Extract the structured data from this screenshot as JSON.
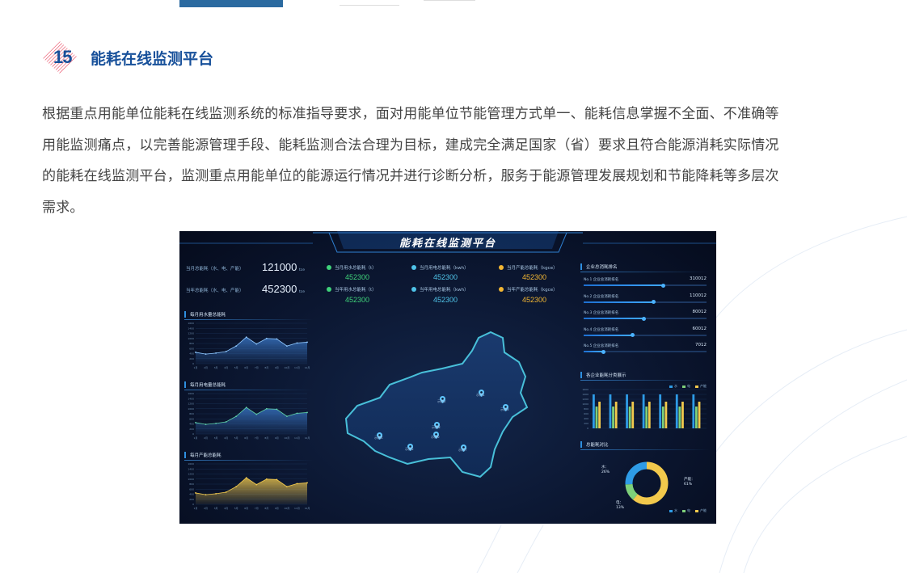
{
  "section": {
    "number": "15",
    "title": "能耗在线监测平台",
    "paragraph_lines": [
      "根据重点用能单位能耗在线监测系统的标准指导要求，面对用能单位节能管理方式单一、能耗信息掌握不全面、不准确等",
      "用能监测痛点，以完善能源管理手段、能耗监测合法合理为目标，建成完全满足国家（省）要求且符合能源消耗实际情况",
      "的能耗在线监测平台，监测重点用能单位的能源运行情况并进行诊断分析，服务于能源管理发展规划和节能降耗等多层次",
      "需求。"
    ]
  },
  "dashboard": {
    "title": "能耗在线监测平台",
    "summary": [
      {
        "label": "当月总能耗（水、电、产能）",
        "value": "121000",
        "unit": "tce"
      },
      {
        "label": "当年总能耗（水、电、产能）",
        "value": "452300",
        "unit": "tce"
      }
    ],
    "kpis": [
      {
        "label": "当月用水总能耗（t）",
        "value": "452300",
        "color": "#3fd27a"
      },
      {
        "label": "当月用电总能耗（kwh）",
        "value": "452300",
        "color": "#4fc3e8"
      },
      {
        "label": "当月产能总能耗（kgce）",
        "value": "452300",
        "color": "#f2b633"
      },
      {
        "label": "当年用水总能耗（t）",
        "value": "452300",
        "color": "#3fd27a"
      },
      {
        "label": "当年用电总能耗（kwh）",
        "value": "452300",
        "color": "#4fc3e8"
      },
      {
        "label": "当年产能总能耗（kgce）",
        "value": "452300",
        "color": "#f2b633"
      }
    ],
    "panels": {
      "water": "每月用水量总能耗",
      "electric": "每月用电量总能耗",
      "capacity": "每月产能总能耗",
      "ranking": "企业总消耗排名",
      "category": "各企业能耗分类展示",
      "ratio": "总能耗对比"
    },
    "ranking": [
      {
        "label": "No.1 企业总消耗排名",
        "value": "310012",
        "frac": 0.65
      },
      {
        "label": "No.2 企业总消耗排名",
        "value": "110012",
        "frac": 0.57
      },
      {
        "label": "No.3 企业总消耗排名",
        "value": "80012",
        "frac": 0.49
      },
      {
        "label": "No.4 企业总消耗排名",
        "value": "60012",
        "frac": 0.4
      },
      {
        "label": "No.5 企业总消耗排名",
        "value": "7012",
        "frac": 0.16
      }
    ],
    "map_markers": [
      "示例1",
      "示例2",
      "示例3",
      "示例4",
      "示例5",
      "示例6",
      "示例7",
      "示例8"
    ],
    "legend": [
      "水",
      "电",
      "产能"
    ],
    "colors": {
      "water": "#2e9be6",
      "electric": "#7ed07a",
      "capacity": "#f2c94c",
      "line": "#5fb8ff"
    }
  },
  "chart_data": [
    {
      "type": "area",
      "title": "每月用水量总能耗",
      "categories": [
        "1月",
        "2月",
        "3月",
        "4月",
        "5月",
        "6月",
        "7月",
        "8月",
        "9月",
        "10月",
        "11月",
        "12月"
      ],
      "values": [
        450,
        380,
        420,
        480,
        700,
        1050,
        780,
        1000,
        980,
        700,
        820,
        850
      ],
      "ylim": [
        0,
        1600
      ],
      "yticks": [
        "1600",
        "1400",
        "1200",
        "1000",
        "800",
        "600",
        "400",
        "200",
        "0"
      ]
    },
    {
      "type": "area",
      "title": "每月用电量总能耗",
      "categories": [
        "1月",
        "2月",
        "3月",
        "4月",
        "5月",
        "6月",
        "7月",
        "8月",
        "9月",
        "10月",
        "11月",
        "12月"
      ],
      "values": [
        450,
        380,
        420,
        480,
        700,
        1050,
        780,
        1000,
        980,
        700,
        820,
        850
      ],
      "ylim": [
        0,
        1600
      ],
      "yticks": [
        "1600",
        "1400",
        "1200",
        "1000",
        "800",
        "600",
        "400",
        "200",
        "0"
      ]
    },
    {
      "type": "area",
      "title": "每月产能总能耗",
      "categories": [
        "1月",
        "2月",
        "3月",
        "4月",
        "5月",
        "6月",
        "7月",
        "8月",
        "9月",
        "10月",
        "11月",
        "12月"
      ],
      "values": [
        450,
        380,
        420,
        480,
        700,
        1050,
        780,
        1000,
        980,
        700,
        820,
        850
      ],
      "ylim": [
        0,
        1600
      ],
      "yticks": [
        "1600",
        "1400",
        "1200",
        "1000",
        "800",
        "600",
        "400",
        "200",
        "0"
      ]
    },
    {
      "type": "bar",
      "title": "各企业能耗分类展示",
      "categories": [
        "1",
        "2",
        "3",
        "4",
        "5",
        "6",
        "7"
      ],
      "series": [
        {
          "name": "水",
          "values": [
            1400,
            1400,
            1400,
            1400,
            1400,
            1400,
            1400
          ]
        },
        {
          "name": "电",
          "values": [
            900,
            900,
            900,
            900,
            900,
            900,
            900
          ]
        },
        {
          "name": "产能",
          "values": [
            1100,
            1100,
            1100,
            1100,
            1100,
            1100,
            1100
          ]
        }
      ],
      "ylim": [
        0,
        1600
      ],
      "yticks": [
        "1600",
        "1400",
        "1200",
        "1000",
        "800",
        "600",
        "400",
        "200",
        "0"
      ]
    },
    {
      "type": "pie",
      "title": "总能耗对比",
      "categories": [
        "水",
        "电",
        "产能"
      ],
      "values": [
        26,
        13,
        61
      ],
      "labels": [
        "水：\n26%",
        "电：\n13%",
        "产能：\n61%"
      ]
    }
  ]
}
